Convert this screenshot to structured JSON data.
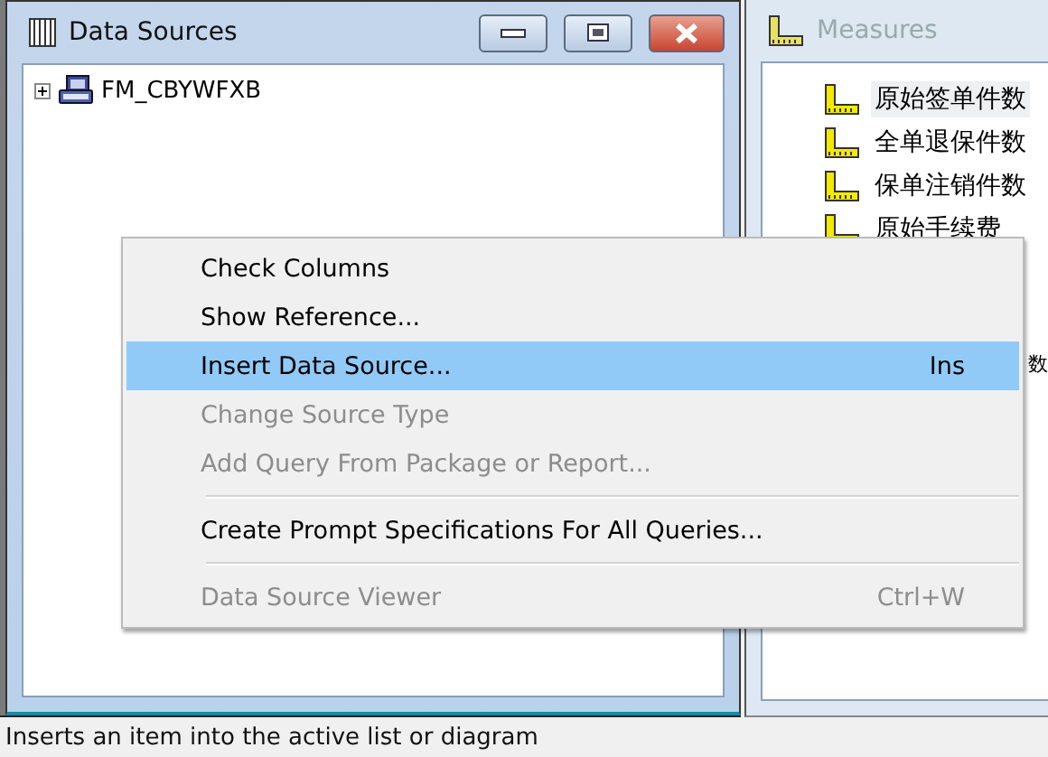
{
  "data_sources_window": {
    "title": "Data Sources",
    "active": true,
    "tree": [
      {
        "label": "FM_CBYWFXB",
        "expanded": false
      }
    ]
  },
  "measures_pane": {
    "title": "Measures",
    "active": false,
    "items": [
      {
        "label": "原始签单件数",
        "kind": "full",
        "selected": true
      },
      {
        "label": "全单退保件数",
        "kind": "full",
        "selected": false
      },
      {
        "label": "保单注销件数",
        "kind": "full",
        "selected": false
      },
      {
        "label": "原始手续费",
        "kind": "full",
        "selected": false
      },
      {
        "label": "数",
        "kind": "partial",
        "selected": false
      }
    ]
  },
  "context_menu": {
    "items": [
      {
        "kind": "item",
        "label": "Check Columns",
        "disabled": false,
        "selected": false
      },
      {
        "kind": "item",
        "label": "Show Reference...",
        "disabled": false,
        "selected": false
      },
      {
        "kind": "item",
        "label": "Insert Data Source...",
        "shortcut": "Ins",
        "disabled": false,
        "selected": true
      },
      {
        "kind": "item",
        "label": "Change Source Type",
        "disabled": true,
        "selected": false
      },
      {
        "kind": "item",
        "label": "Add Query From Package or Report...",
        "disabled": true,
        "selected": false
      },
      {
        "kind": "separator"
      },
      {
        "kind": "item",
        "label": "Create Prompt Specifications For All Queries...",
        "disabled": false,
        "selected": false
      },
      {
        "kind": "separator"
      },
      {
        "kind": "item",
        "label": "Data Source Viewer",
        "shortcut": "Ctrl+W",
        "disabled": true,
        "selected": false
      }
    ]
  },
  "status_bar": {
    "text": "Inserts an item into the active list or diagram"
  }
}
